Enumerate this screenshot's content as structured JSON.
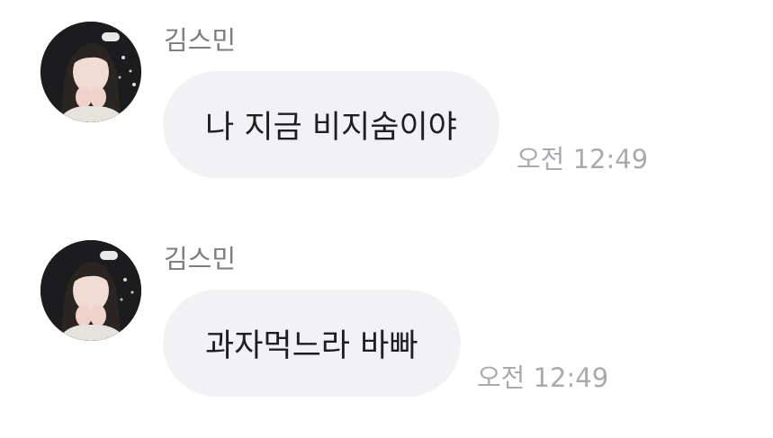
{
  "messages": [
    {
      "sender": "김스민",
      "text": "나 지금 비지숨이야",
      "time": "오전 12:49"
    },
    {
      "sender": "김스민",
      "text": "과자먹느라 바빠",
      "time": "오전 12:49"
    }
  ],
  "colors": {
    "bubble": "#f2f2f4",
    "sender": "#7b7b80",
    "time": "#a9a9ae",
    "text": "#1f1f22"
  }
}
